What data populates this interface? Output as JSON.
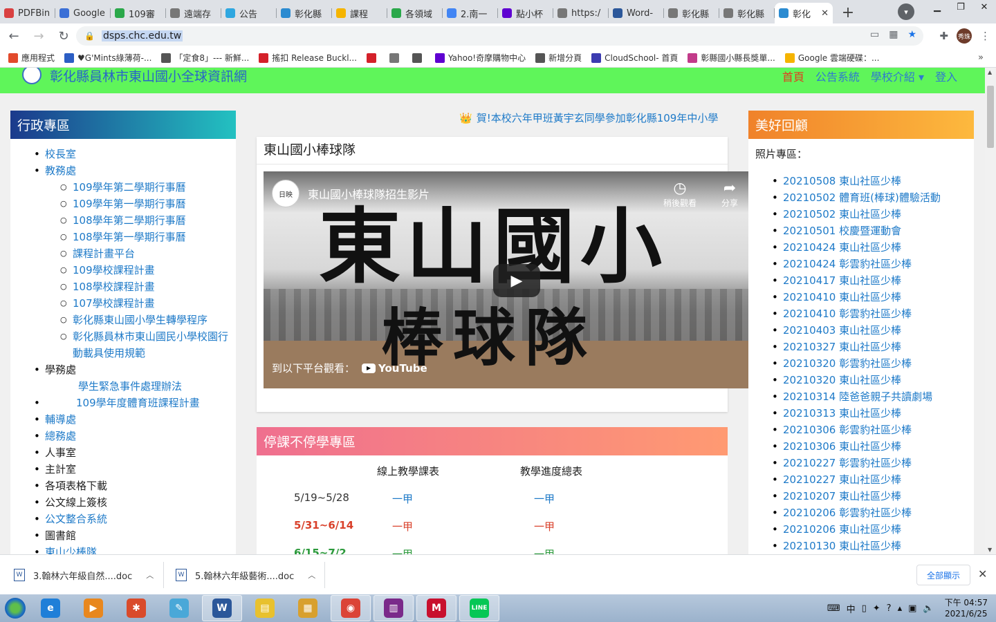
{
  "browser": {
    "tabs": [
      {
        "label": "PDFBin",
        "color": "#d94040"
      },
      {
        "label": "Google",
        "color": "#3b6fd6"
      },
      {
        "label": "109審",
        "color": "#2aa84a"
      },
      {
        "label": "遠端存",
        "color": "#777777"
      },
      {
        "label": "公告",
        "color": "#2fa7e0"
      },
      {
        "label": "彰化縣",
        "color": "#2b8bd1"
      },
      {
        "label": "課程",
        "color": "#f5b400"
      },
      {
        "label": "各領域",
        "color": "#2aa84a"
      },
      {
        "label": "2.南一",
        "color": "#4285f4"
      },
      {
        "label": "點小杯",
        "color": "#5f01d1"
      },
      {
        "label": "https:/",
        "color": "#777777"
      },
      {
        "label": "Word-",
        "color": "#2b579a"
      },
      {
        "label": "彰化縣",
        "color": "#777777"
      },
      {
        "label": "彰化縣",
        "color": "#777777"
      },
      {
        "label": "彰化",
        "color": "#2b8bd1",
        "active": true
      }
    ],
    "tab_close_glyph": "✕",
    "url": "dsps.chc.edu.tw",
    "avatar_text": "秀珠",
    "bookmarks": [
      {
        "label": "應用程式",
        "color": "#e24a2c"
      },
      {
        "label": "♥G'Mints綠薄荷-...",
        "color": "#2c5ec4"
      },
      {
        "label": "「定食8」--- 新鮮...",
        "color": "#555555"
      },
      {
        "label": "搖扣 Release Buckl...",
        "color": "#d4212a"
      },
      {
        "label": "",
        "color": "#d4212a"
      },
      {
        "label": "",
        "color": "#777777"
      },
      {
        "label": "",
        "color": "#555555"
      },
      {
        "label": "Yahoo!奇摩購物中心",
        "color": "#5f01d1"
      },
      {
        "label": "新增分頁",
        "color": "#555555"
      },
      {
        "label": "CloudSchool- 首頁",
        "color": "#3b3bb0"
      },
      {
        "label": "彰縣國小縣長獎單...",
        "color": "#c23b8a"
      },
      {
        "label": "Google 雲端硬碟：...",
        "color": "#f5b400"
      }
    ],
    "bookmarks_more": "»"
  },
  "site": {
    "title": "彰化縣員林市東山國小全球資訊網",
    "nav": [
      "首頁",
      "公告系統",
      "學校介紹 ▾",
      "登入"
    ]
  },
  "left_panel": {
    "heading": "行政專區",
    "items": [
      {
        "label": "校長室",
        "level": 1,
        "link": true
      },
      {
        "label": "教務處",
        "level": 1,
        "link": true
      },
      {
        "label": "109學年第二學期行事曆",
        "level": 2,
        "link": true
      },
      {
        "label": "109學年第一學期行事曆",
        "level": 2,
        "link": true
      },
      {
        "label": "108學年第二學期行事曆",
        "level": 2,
        "link": true
      },
      {
        "label": "108學年第一學期行事曆",
        "level": 2,
        "link": true
      },
      {
        "label": "課程計畫平台",
        "level": 2,
        "link": true
      },
      {
        "label": "109學校課程計畫",
        "level": 2,
        "link": true
      },
      {
        "label": "108學校課程計畫",
        "level": 2,
        "link": true
      },
      {
        "label": "107學校課程計畫",
        "level": 2,
        "link": true
      },
      {
        "label": "彰化縣東山國小學生轉學程序",
        "level": 2,
        "link": true
      },
      {
        "label": "彰化縣員林市東山國民小學校園行動載具使用規範",
        "level": 2,
        "link": true
      },
      {
        "label": "學務處",
        "level": 1,
        "link": false
      },
      {
        "label": "學生緊急事件處理辦法",
        "level": 3,
        "link": true
      },
      {
        "label": "109學年度體育班課程計畫",
        "level": 4,
        "link": true
      },
      {
        "label": "輔導處",
        "level": 1,
        "link": true
      },
      {
        "label": "總務處",
        "level": 1,
        "link": true
      },
      {
        "label": "人事室",
        "level": 1,
        "link": false
      },
      {
        "label": "主計室",
        "level": 1,
        "link": false
      },
      {
        "label": "各項表格下載",
        "level": 1,
        "link": false
      },
      {
        "label": "公文線上簽核",
        "level": 1,
        "link": false
      },
      {
        "label": "公文整合系統",
        "level": 1,
        "link": true
      },
      {
        "label": "圖書館",
        "level": 1,
        "link": false
      },
      {
        "label": "東山少棒隊",
        "level": 1,
        "link": true
      }
    ]
  },
  "marquee": {
    "icon": "👑",
    "text": "賀!本校六年甲班黃宇玄同學參加彰化縣109年中小學"
  },
  "video_card": {
    "title": "東山國小棒球隊",
    "video_title": "東山國小棒球隊招生影片",
    "channel_logo": "日映",
    "calligraphy_top": "東山國小",
    "calligraphy_bottom": "棒球隊",
    "watch_later": "稍後觀看",
    "share": "分享",
    "watch_on": "到以下平台觀看：",
    "youtube": "YouTube"
  },
  "remote_card": {
    "heading": "停課不停學專區",
    "col1": "線上教學課表",
    "col2": "教學進度總表",
    "rows": [
      {
        "date": "5/19~5/28",
        "c1": "一甲",
        "c2": "一甲",
        "color": "#333333",
        "link": "#1e7ac8"
      },
      {
        "date": "5/31~6/14",
        "c1": "一甲",
        "c2": "一甲",
        "color": "#d9412b",
        "link": "#d9412b"
      },
      {
        "date": "6/15~7/2",
        "c1": "一甲",
        "c2": "一甲",
        "color": "#2c9a3c",
        "link": "#2c9a3c"
      }
    ]
  },
  "right_panel": {
    "heading": "美好回顧",
    "label": "照片專區：",
    "items": [
      "20210508 東山社區少棒",
      "20210502 體育班(棒球)體驗活動",
      "20210502 東山社區少棒",
      "20210501 校慶暨運動會",
      "20210424 東山社區少棒",
      "20210424 彰雲豹社區少棒",
      "20210417 東山社區少棒",
      "20210410 東山社區少棒",
      "20210410 彰雲豹社區少棒",
      "20210403 東山社區少棒",
      "20210327 東山社區少棒",
      "20210320 彰雲豹社區少棒",
      "20210320 東山社區少棒",
      "20210314 陸爸爸親子共讀劇場",
      "20210313 東山社區少棒",
      "20210306 彰雲豹社區少棒",
      "20210306 東山社區少棒",
      "20210227 彰雲豹社區少棒",
      "20210227 東山社區少棒",
      "20210207 東山社區少棒",
      "20210206 彰雲豹社區少棒",
      "20210206 東山社區少棒",
      "20210130 東山社區少棒"
    ]
  },
  "downloads": {
    "items": [
      "3.翰林六年級自然....doc",
      "5.翰林六年級藝術....doc"
    ],
    "show_all": "全部顯示",
    "close": "✕"
  },
  "taskbar": {
    "apps": [
      {
        "name": "ie",
        "color": "#1f7fd8",
        "glyph": "e"
      },
      {
        "name": "media",
        "color": "#e8871e",
        "glyph": "▶"
      },
      {
        "name": "tools",
        "color": "#d94b2b",
        "glyph": "✱"
      },
      {
        "name": "notepad",
        "color": "#4aa8d8",
        "glyph": "✎"
      },
      {
        "name": "word",
        "color": "#2b579a",
        "glyph": "W",
        "active": true
      },
      {
        "name": "folder-notes",
        "color": "#e8c12e",
        "glyph": "▤"
      },
      {
        "name": "explorer",
        "color": "#d8a02e",
        "glyph": "▦"
      },
      {
        "name": "chrome",
        "color": "#db4437",
        "glyph": "◉",
        "active": true
      },
      {
        "name": "winrar",
        "color": "#7a2a8a",
        "glyph": "▥",
        "active": true
      },
      {
        "name": "mcafee",
        "color": "#c8102e",
        "glyph": "M",
        "active": true
      },
      {
        "name": "line",
        "color": "#06c755",
        "glyph": "LINE",
        "active": true
      }
    ],
    "tray_text": "中",
    "time": "下午 04:57",
    "date": "2021/6/25"
  }
}
